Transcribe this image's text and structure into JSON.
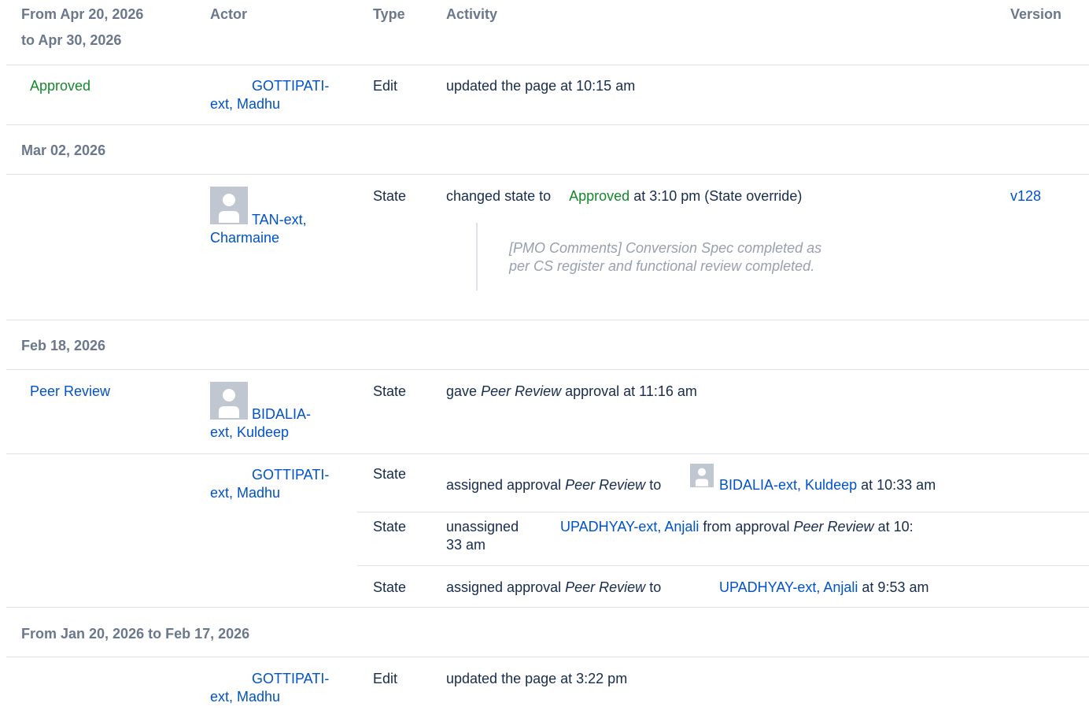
{
  "header": {
    "period_line1": "From Apr 20, 2026",
    "period_line2": "to Apr 30, 2026",
    "actor": "Actor",
    "type": "Type",
    "activity": "Activity",
    "version": "Version"
  },
  "groups": {
    "g1": {
      "status": "Approved",
      "actor_line1": "GOTTIPATI-",
      "actor_line2": "ext, Madhu",
      "type": "Edit",
      "activity": "updated the page at 10:15 am"
    },
    "g2": {
      "date": "Mar 02, 2026",
      "actor_line1": "TAN-ext,",
      "actor_line2": "Charmaine",
      "type": "State",
      "activity_pre": "changed state to",
      "activity_state": "Approved",
      "activity_post": "at 3:10 pm (State override)",
      "version": "v128",
      "comment_line1": "[PMO Comments] Conversion Spec completed as",
      "comment_line2": "per CS register and functional review completed."
    },
    "g3": {
      "date": "Feb 18, 2026",
      "status": "Peer Review",
      "actor_line1": "BIDALIA-",
      "actor_line2": "ext, Kuldeep",
      "type": "State",
      "activity_pre": "gave",
      "activity_em": "Peer Review",
      "activity_post": "approval at 11:16 am"
    },
    "g4": {
      "actor_line1": "GOTTIPATI-",
      "actor_line2": "ext, Madhu",
      "rows": [
        {
          "type": "State",
          "pre": "assigned approval",
          "em": "Peer Review",
          "mid": "to",
          "user": "BIDALIA-ext, Kuldeep",
          "post": "at 10:33 am"
        },
        {
          "type": "State",
          "pre": "unassigned",
          "user": "UPADHYAY-ext, Anjali",
          "mid": "from approval",
          "em": "Peer Review",
          "post": "at 10:",
          "post2": "33 am"
        },
        {
          "type": "State",
          "pre": "assigned approval",
          "em": "Peer Review",
          "mid": "to",
          "user": "UPADHYAY-ext, Anjali",
          "post": "at 9:53 am"
        }
      ]
    },
    "g5": {
      "date": "From Jan 20, 2026 to Feb 17, 2026",
      "actor_line1": "GOTTIPATI-",
      "actor_line2": "ext, Madhu",
      "type": "Edit",
      "activity": "updated the page at 3:22 pm"
    }
  },
  "icons": [
    "user-avatar-icon"
  ],
  "colors": {
    "link": "#0052cc",
    "approved": "#14892c",
    "header_text": "#6b778c",
    "comment_text": "#97a0af",
    "divider": "#dfe1e6"
  }
}
